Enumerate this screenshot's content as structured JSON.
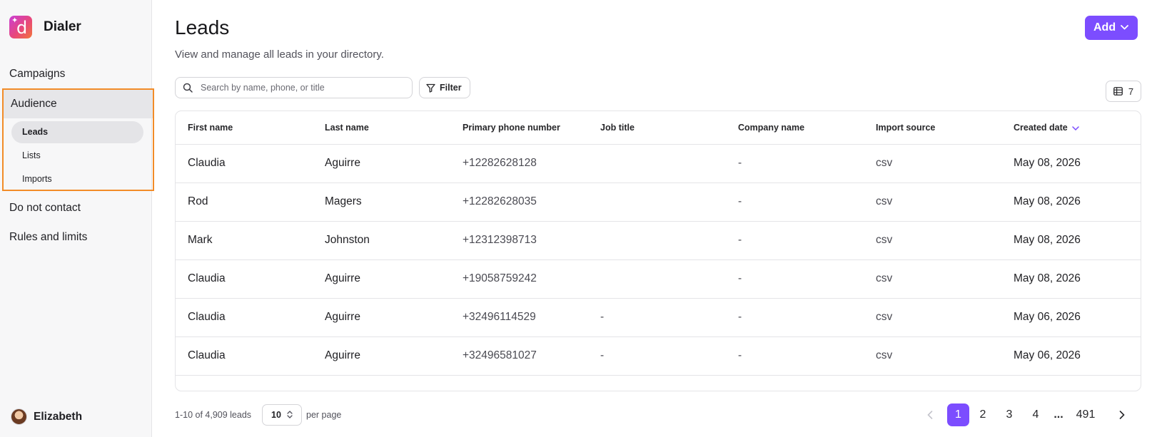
{
  "app": {
    "name": "Dialer"
  },
  "sidebar": {
    "campaigns": "Campaigns",
    "audience": "Audience",
    "audience_items": [
      "Leads",
      "Lists",
      "Imports"
    ],
    "do_not_contact": "Do not contact",
    "rules": "Rules and limits",
    "user": "Elizabeth"
  },
  "header": {
    "title": "Leads",
    "subtitle": "View and manage all leads in your directory.",
    "add_label": "Add"
  },
  "toolbar": {
    "search_placeholder": "Search by name, phone, or title",
    "filter_label": "Filter",
    "columns_count": "7"
  },
  "table": {
    "columns": [
      "First name",
      "Last name",
      "Primary phone number",
      "Job title",
      "Company name",
      "Import source",
      "Created date"
    ],
    "rows": [
      [
        "Claudia",
        "Aguirre",
        "+12282628128",
        "",
        "-",
        "csv",
        "May 08, 2026"
      ],
      [
        "Rod",
        "Magers",
        "+12282628035",
        "",
        "-",
        "csv",
        "May 08, 2026"
      ],
      [
        "Mark",
        "Johnston",
        "+12312398713",
        "",
        "-",
        "csv",
        "May 08, 2026"
      ],
      [
        "Claudia",
        "Aguirre",
        "+19058759242",
        "",
        "-",
        "csv",
        "May 08, 2026"
      ],
      [
        "Claudia",
        "Aguirre",
        "+32496114529",
        "-",
        "-",
        "csv",
        "May 06, 2026"
      ],
      [
        "Claudia",
        "Aguirre",
        "+32496581027",
        "-",
        "-",
        "csv",
        "May 06, 2026"
      ]
    ]
  },
  "footer": {
    "range": "1-10 of 4,909 leads",
    "per_page_value": "10",
    "per_page_label": "per page",
    "pages": [
      "1",
      "2",
      "3",
      "4",
      "...",
      "491"
    ],
    "current_page": "1"
  },
  "colors": {
    "accent": "#7c4dff",
    "highlight": "#f28c28"
  }
}
